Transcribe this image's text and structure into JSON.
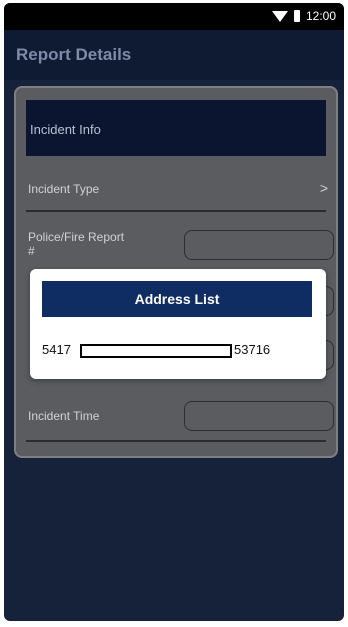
{
  "status_bar": {
    "time": "12:00"
  },
  "app_bar": {
    "title": "Report Details"
  },
  "form": {
    "section_title": "Incident Info",
    "incident_type_label": "Incident Type",
    "incident_type_chevron": ">",
    "police_report_label_line1": "Police/Fire Report",
    "police_report_label_line2": "#",
    "incident_time_label": "Incident Time"
  },
  "dialog": {
    "title": "Address List",
    "address_prefix": "5417",
    "address_suffix": "53716"
  }
}
